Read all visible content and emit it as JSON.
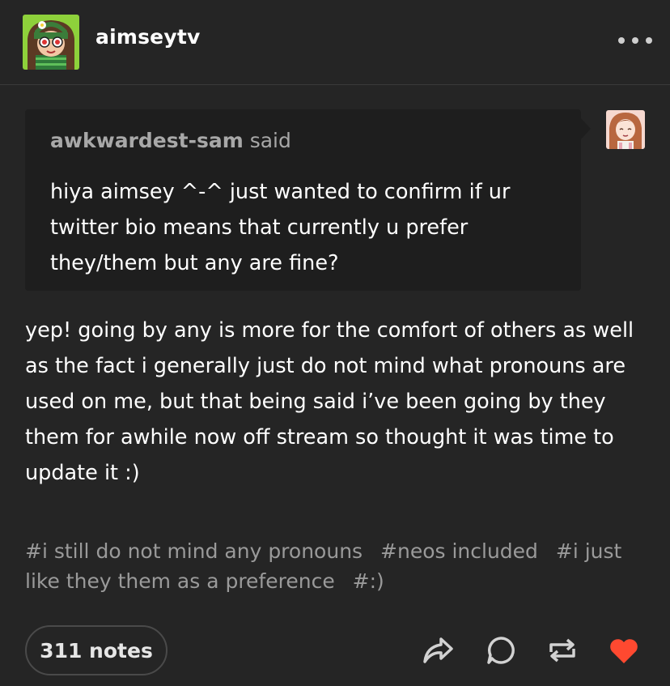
{
  "post": {
    "blog_name": "aimseytv",
    "ask": {
      "asker": "awkwardest-sam",
      "said": "said",
      "question": "hiya aimsey ^-^ just wanted to confirm if ur twitter bio means that currently u prefer they/them but any are fine?"
    },
    "answer": "yep! going by any is more for the comfort of others as well as the fact i generally just do not mind what pronouns are used on me, but that being said i’ve been going by they them for awhile now off stream so thought it was time to update it :)",
    "tags": [
      "#i still do not mind any pronouns",
      "#neos included",
      "#i just like they them as a preference",
      "#:)"
    ],
    "notes_label": "311 notes"
  },
  "icons": {
    "more": "more-options-icon",
    "share": "share-icon",
    "reply": "reply-icon",
    "reblog": "reblog-icon",
    "like": "heart-icon"
  },
  "colors": {
    "background": "#252525",
    "ask_background": "#1e1e1e",
    "like_active": "#ff4930",
    "tag_text": "#9a9a9a"
  }
}
